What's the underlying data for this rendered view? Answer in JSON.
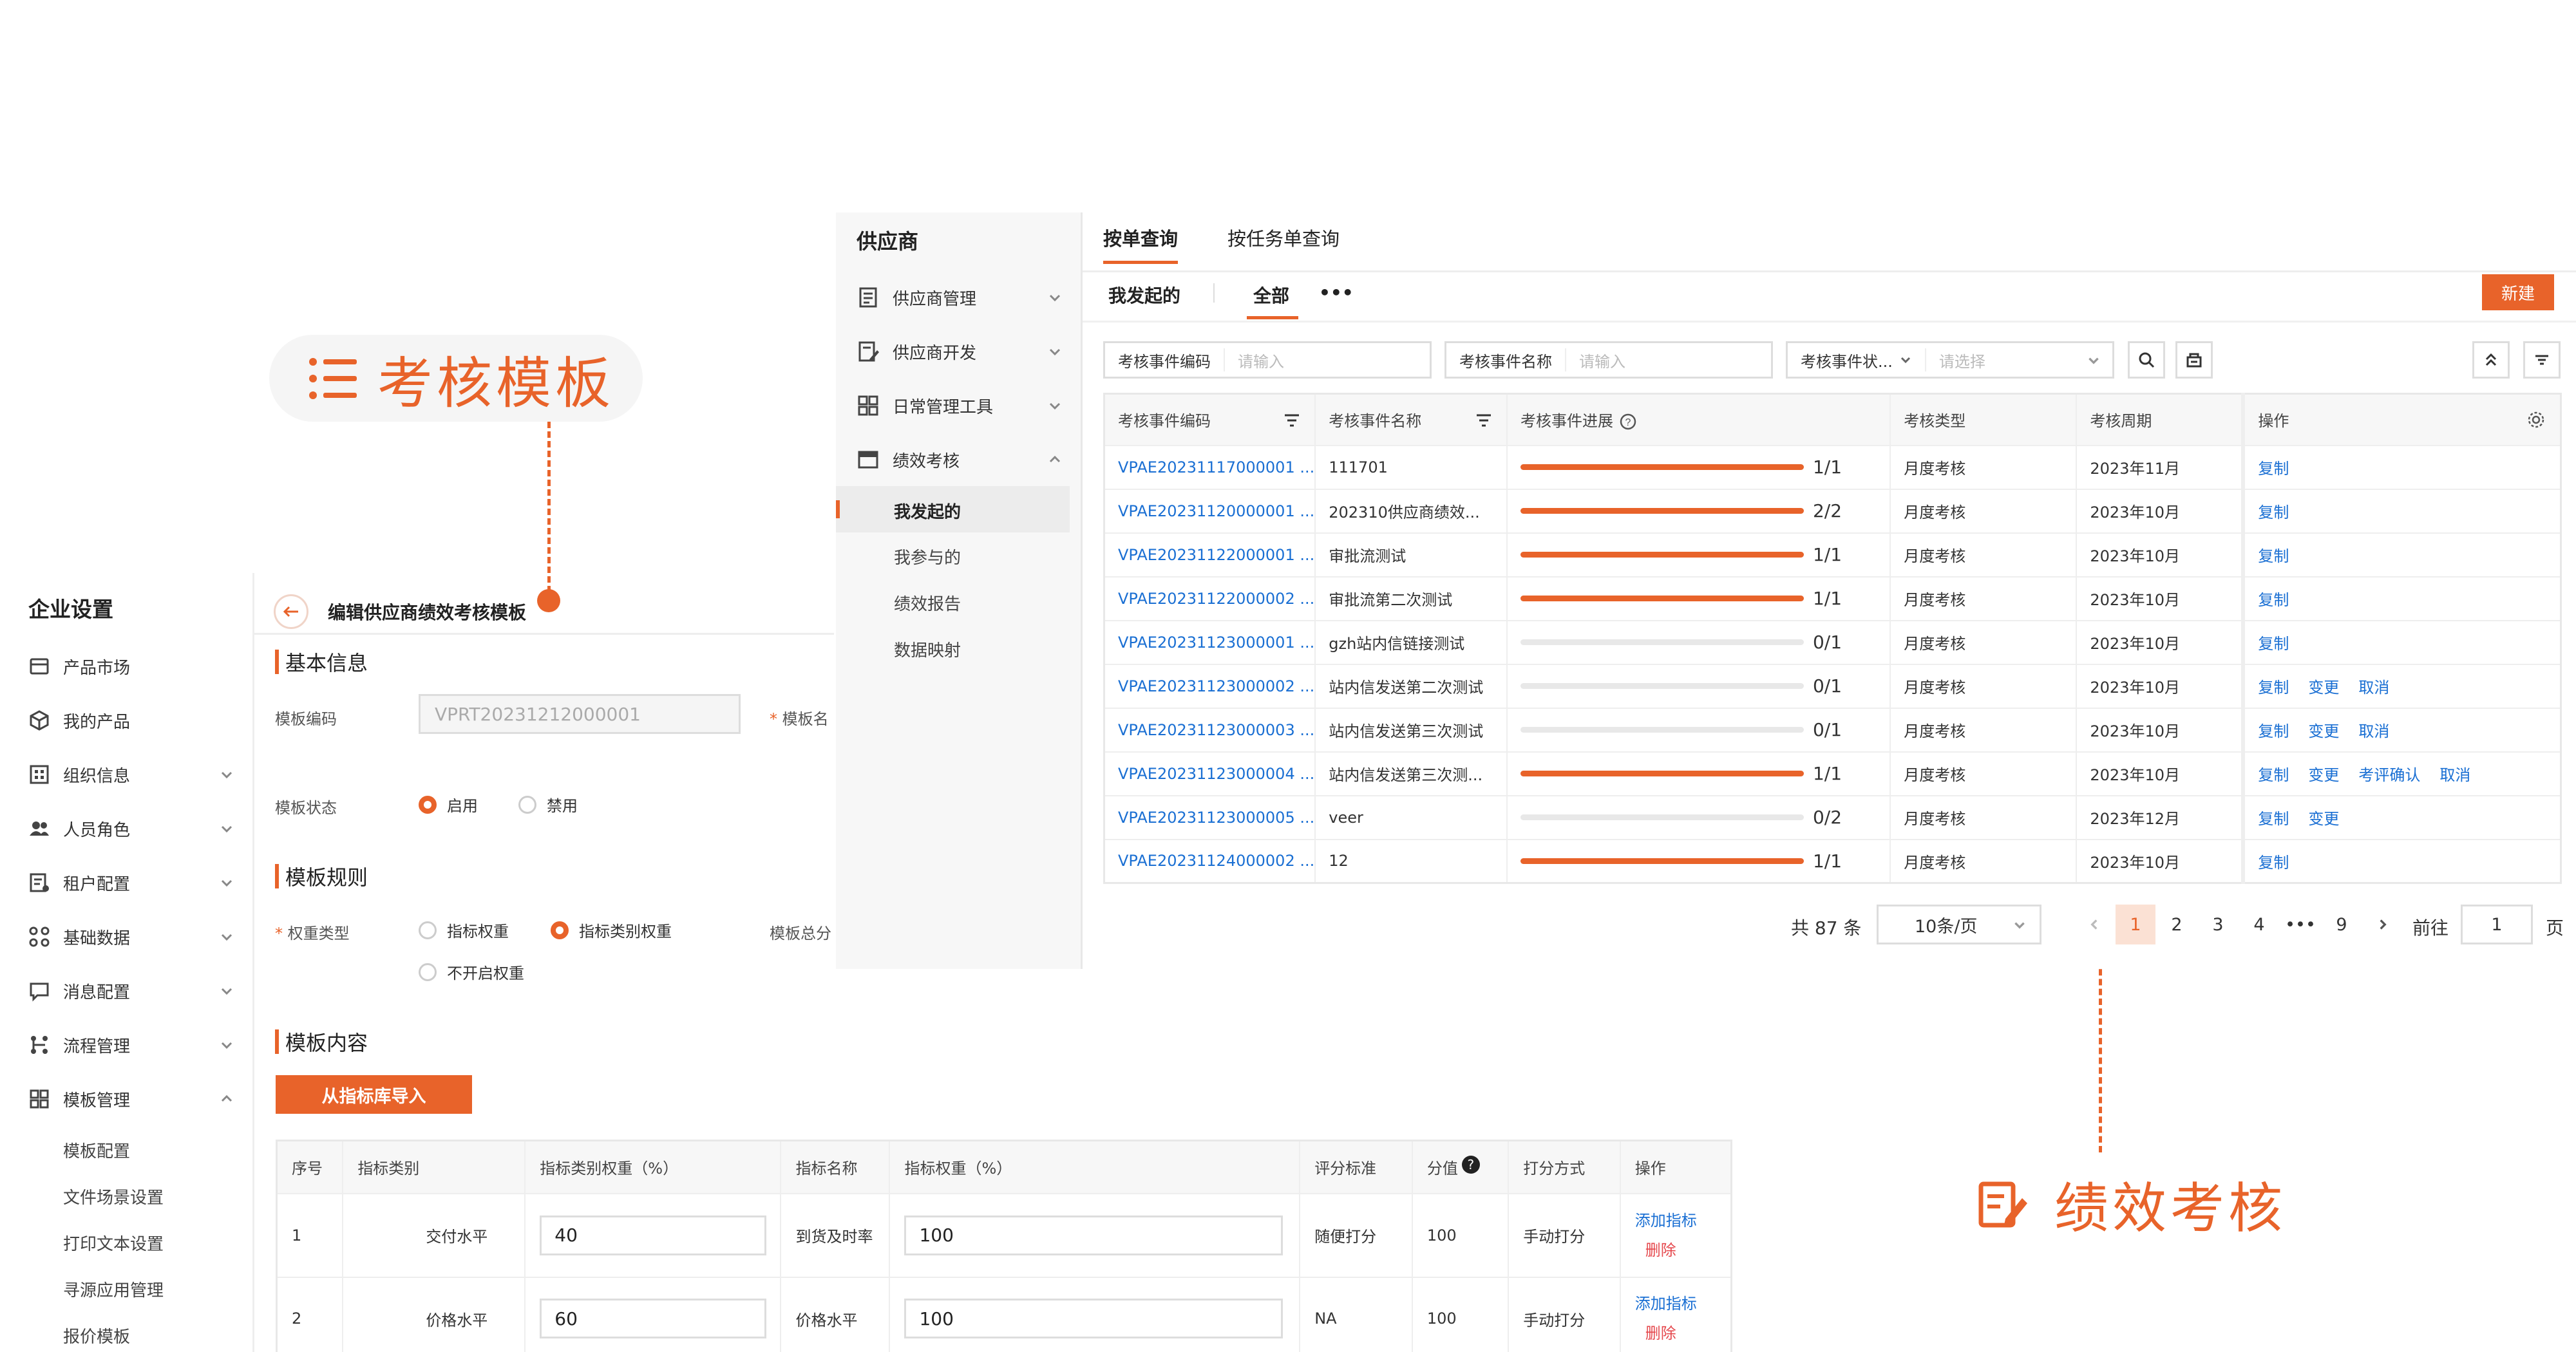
{
  "callouts": {
    "template": "考核模板",
    "performance": "绩效考核"
  },
  "enterprise": {
    "title": "企业设置",
    "items": [
      {
        "label": "产品市场",
        "icon": "store-icon"
      },
      {
        "label": "我的产品",
        "icon": "cube-icon"
      },
      {
        "label": "组织信息",
        "icon": "org-icon"
      },
      {
        "label": "人员角色",
        "icon": "users-icon"
      },
      {
        "label": "租户配置",
        "icon": "tenant-icon"
      },
      {
        "label": "基础数据",
        "icon": "data-icon"
      },
      {
        "label": "消息配置",
        "icon": "message-icon"
      },
      {
        "label": "流程管理",
        "icon": "flow-icon"
      },
      {
        "label": "模板管理",
        "icon": "template-icon"
      }
    ],
    "subitems": [
      "模板配置",
      "文件场景设置",
      "打印文本设置",
      "寻源应用管理",
      "报价模板"
    ]
  },
  "edit": {
    "title": "编辑供应商绩效考核模板",
    "sec_basic": "基本信息",
    "code_label": "模板编码",
    "code_value": "VPRT20231212000001",
    "name_label": "模板名",
    "status_label": "模板状态",
    "status_on": "启用",
    "status_off": "禁用",
    "sec_rules": "模板规则",
    "weight_label": "权重类型",
    "weight_opt1": "指标权重",
    "weight_opt2": "指标类别权重",
    "weight_opt3": "不开启权重",
    "total_label": "模板总分",
    "sec_content": "模板内容",
    "import_btn": "从指标库导入",
    "table_headers": [
      "序号",
      "指标类别",
      "指标类别权重（%）",
      "指标名称",
      "指标权重（%）",
      "评分标准",
      "分值",
      "打分方式",
      "操作"
    ],
    "rows": [
      {
        "no": "1",
        "category": "交付水平",
        "cat_weight": "40",
        "name": "到货及时率",
        "weight": "100",
        "standard": "随便打分",
        "score": "100",
        "method": "手动打分",
        "op_add": "添加指标",
        "op_del": "删除"
      },
      {
        "no": "2",
        "category": "价格水平",
        "cat_weight": "60",
        "name": "价格水平",
        "weight": "100",
        "standard": "NA",
        "score": "100",
        "method": "手动打分",
        "op_add": "添加指标",
        "op_del": "删除"
      }
    ]
  },
  "supplier": {
    "title": "供应商",
    "items": [
      {
        "label": "供应商管理",
        "icon": "doc-icon"
      },
      {
        "label": "供应商开发",
        "icon": "doc-edit-icon"
      },
      {
        "label": "日常管理工具",
        "icon": "grid-icon"
      },
      {
        "label": "绩效考核",
        "icon": "card-icon"
      }
    ],
    "subitems": [
      "我发起的",
      "我参与的",
      "绩效报告",
      "数据映射"
    ],
    "active_sub": "我发起的"
  },
  "main": {
    "tabs": [
      "按单查询",
      "按任务单查询"
    ],
    "subtabs": [
      "我发起的",
      "全部"
    ],
    "more": "•••",
    "new_btn": "新建",
    "filters": [
      {
        "label": "考核事件编码",
        "placeholder": "请输入"
      },
      {
        "label": "考核事件名称",
        "placeholder": "请输入"
      },
      {
        "label": "考核事件状...",
        "placeholder": "请选择"
      }
    ],
    "headers": [
      "考核事件编码",
      "考核事件名称",
      "考核事件进展",
      "考核类型",
      "考核周期",
      "操作"
    ],
    "rows": [
      {
        "code": "VPAE20231117000001 ...",
        "name": "111701",
        "progress": 1.0,
        "progress_text": "1/1",
        "type": "月度考核",
        "period": "2023年11月",
        "ops": [
          "复制"
        ]
      },
      {
        "code": "VPAE20231120000001 ...",
        "name": "202310供应商绩效...",
        "progress": 1.0,
        "progress_text": "2/2",
        "type": "月度考核",
        "period": "2023年10月",
        "ops": [
          "复制"
        ]
      },
      {
        "code": "VPAE20231122000001 ...",
        "name": "审批流测试",
        "progress": 1.0,
        "progress_text": "1/1",
        "type": "月度考核",
        "period": "2023年10月",
        "ops": [
          "复制"
        ]
      },
      {
        "code": "VPAE20231122000002 ...",
        "name": "审批流第二次测试",
        "progress": 1.0,
        "progress_text": "1/1",
        "type": "月度考核",
        "period": "2023年10月",
        "ops": [
          "复制"
        ]
      },
      {
        "code": "VPAE20231123000001 ...",
        "name": "gzh站内信链接测试",
        "progress": 0,
        "progress_text": "0/1",
        "type": "月度考核",
        "period": "2023年10月",
        "ops": [
          "复制"
        ]
      },
      {
        "code": "VPAE20231123000002 ...",
        "name": "站内信发送第二次测试",
        "progress": 0,
        "progress_text": "0/1",
        "type": "月度考核",
        "period": "2023年10月",
        "ops": [
          "复制",
          "变更",
          "取消"
        ]
      },
      {
        "code": "VPAE20231123000003 ...",
        "name": "站内信发送第三次测试",
        "progress": 0,
        "progress_text": "0/1",
        "type": "月度考核",
        "period": "2023年10月",
        "ops": [
          "复制",
          "变更",
          "取消"
        ]
      },
      {
        "code": "VPAE20231123000004 ...",
        "name": "站内信发送第三次测...",
        "progress": 1.0,
        "progress_text": "1/1",
        "type": "月度考核",
        "period": "2023年10月",
        "ops": [
          "复制",
          "变更",
          "考评确认",
          "取消"
        ]
      },
      {
        "code": "VPAE20231123000005 ...",
        "name": "veer",
        "progress": 0,
        "progress_text": "0/2",
        "type": "月度考核",
        "period": "2023年12月",
        "ops": [
          "复制",
          "变更"
        ]
      },
      {
        "code": "VPAE20231124000002 ...",
        "name": "12",
        "progress": 1.0,
        "progress_text": "1/1",
        "type": "月度考核",
        "period": "2023年10月",
        "ops": [
          "复制"
        ]
      }
    ],
    "pagination": {
      "total": "共 87 条",
      "page_size": "10条/页",
      "pages": [
        "1",
        "2",
        "3",
        "4",
        "•••",
        "9"
      ],
      "current": "1",
      "goto_label": "前往",
      "goto_value": "1",
      "goto_suffix": "页"
    }
  },
  "colors": {
    "accent": "#e8632a",
    "link": "#1a6fd3",
    "danger": "#e5484d"
  }
}
